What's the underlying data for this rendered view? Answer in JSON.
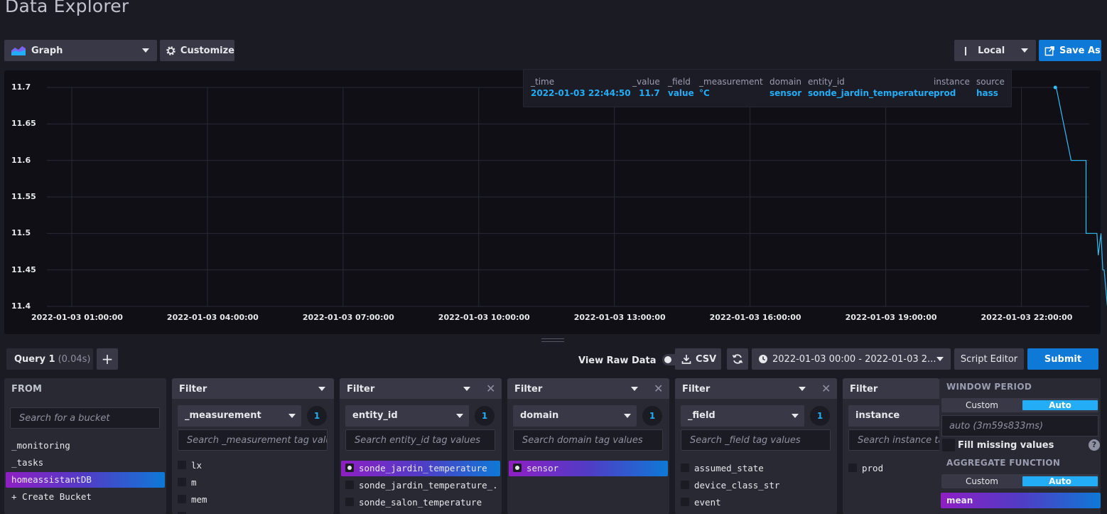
{
  "page": {
    "title": "Data Explorer"
  },
  "toolbar": {
    "viz_type": "Graph",
    "customize": "Customize",
    "timezone": "Local",
    "save_as": "Save As"
  },
  "tooltip": {
    "columns": [
      {
        "header": "_time",
        "value": "2022-01-03 22:44:50"
      },
      {
        "header": "_value",
        "value": "11.7"
      },
      {
        "header": "_field",
        "value": "value"
      },
      {
        "header": "_measurement",
        "value": "°C"
      },
      {
        "header": "domain",
        "value": "sensor"
      },
      {
        "header": "entity_id",
        "value": "sonde_jardin_temperature"
      },
      {
        "header": "instance",
        "value": "prod"
      },
      {
        "header": "source",
        "value": "hass"
      }
    ]
  },
  "chart_data": {
    "type": "line",
    "title": "",
    "xlabel": "",
    "ylabel": "",
    "y_ticks": [
      "11.7",
      "11.65",
      "11.6",
      "11.55",
      "11.5",
      "11.45",
      "11.4"
    ],
    "x_ticks": [
      "2022-01-03 01:00:00",
      "2022-01-03 04:00:00",
      "2022-01-03 07:00:00",
      "2022-01-03 10:00:00",
      "2022-01-03 13:00:00",
      "2022-01-03 16:00:00",
      "2022-01-03 19:00:00",
      "2022-01-03 22:00:00"
    ],
    "ylim": [
      11.4,
      11.7
    ],
    "xlim_hours": [
      0.45,
      23.5
    ],
    "grid": true,
    "series": [
      {
        "color": "#31c0f6",
        "x": [
          22.75,
          22.77,
          23.1,
          23.1,
          23.43,
          23.43,
          23.62,
          23.62,
          23.67,
          23.7,
          23.76,
          23.8,
          23.83,
          23.9
        ],
        "values": [
          11.7,
          11.7,
          11.6,
          11.6,
          11.6,
          11.5,
          11.5,
          11.5,
          11.5,
          11.47,
          11.5,
          11.45,
          11.45,
          11.4
        ]
      }
    ]
  },
  "query_bar": {
    "query_tab": "Query 1",
    "query_time": "(0.04s)",
    "add": "+",
    "view_raw": "View Raw Data",
    "csv": "CSV",
    "time_range": "2022-01-03 00:00 - 2022-01-03 2...",
    "script_editor": "Script Editor",
    "submit": "Submit"
  },
  "from": {
    "header": "FROM",
    "search_placeholder": "Search for a bucket",
    "buckets": [
      "_monitoring",
      "_tasks",
      "homeassistantDB",
      "+ Create Bucket"
    ]
  },
  "filters": [
    {
      "header": "Filter",
      "key": "_measurement",
      "count": "1",
      "search": "Search _measurement tag values",
      "items": [
        "lx",
        "m",
        "mem",
        "mm"
      ],
      "selected": []
    },
    {
      "header": "Filter",
      "key": "entity_id",
      "count": "1",
      "search": "Search entity_id tag values",
      "items": [
        "sonde_jardin_temperature",
        "sonde_jardin_temperature_...",
        "sonde_salon_temperature"
      ],
      "selected": [
        0
      ]
    },
    {
      "header": "Filter",
      "key": "domain",
      "count": "1",
      "search": "Search domain tag values",
      "items": [
        "sensor"
      ],
      "selected": [
        0
      ]
    },
    {
      "header": "Filter",
      "key": "_field",
      "count": "1",
      "search": "Search _field tag values",
      "items": [
        "assumed_state",
        "device_class_str",
        "event"
      ],
      "selected": []
    },
    {
      "header": "Filter",
      "key": "instance",
      "count": "",
      "search": "Search instance tag values",
      "items": [
        "prod"
      ],
      "selected": []
    }
  ],
  "aggregate": {
    "window_period_label": "WINDOW PERIOD",
    "custom": "Custom",
    "auto": "Auto",
    "auto_value": "auto (3m59s833ms)",
    "fill_missing": "Fill missing values",
    "help": "?",
    "aggregate_label": "AGGREGATE FUNCTION",
    "function": "mean"
  }
}
